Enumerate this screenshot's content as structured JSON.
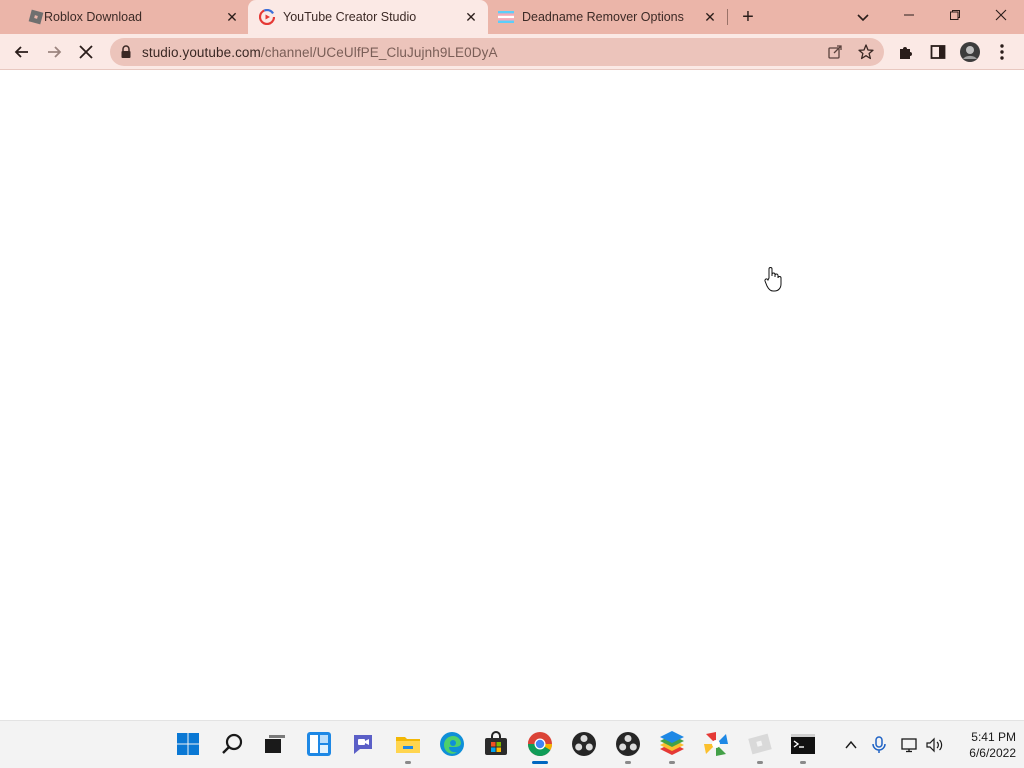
{
  "browser": {
    "tabs": [
      {
        "title": "Roblox Download",
        "favicon": "roblox-icon",
        "active": false
      },
      {
        "title": "YouTube Creator Studio",
        "favicon": "youtube-studio-icon",
        "active": true
      },
      {
        "title": "Deadname Remover Options",
        "favicon": "trans-flag-icon",
        "active": false
      }
    ],
    "url_host": "studio.youtube.com",
    "url_path": "/channel/UCeUlfPE_CluJujnh9LE0DyA",
    "theme_colors": {
      "tabstrip": "#ebb5a9",
      "toolbar": "#fbe9e5",
      "omnibox": "#ecc4bb"
    }
  },
  "taskbar": {
    "apps": [
      "start-icon",
      "search-icon",
      "task-view-icon",
      "widgets-icon",
      "chat-icon",
      "file-explorer-icon",
      "edge-icon",
      "store-icon",
      "chrome-icon",
      "obs-icon",
      "obs-icon",
      "bluestacks-icon",
      "app-icon",
      "roblox-icon",
      "terminal-icon"
    ],
    "time": "5:41 PM",
    "date": "6/6/2022"
  }
}
